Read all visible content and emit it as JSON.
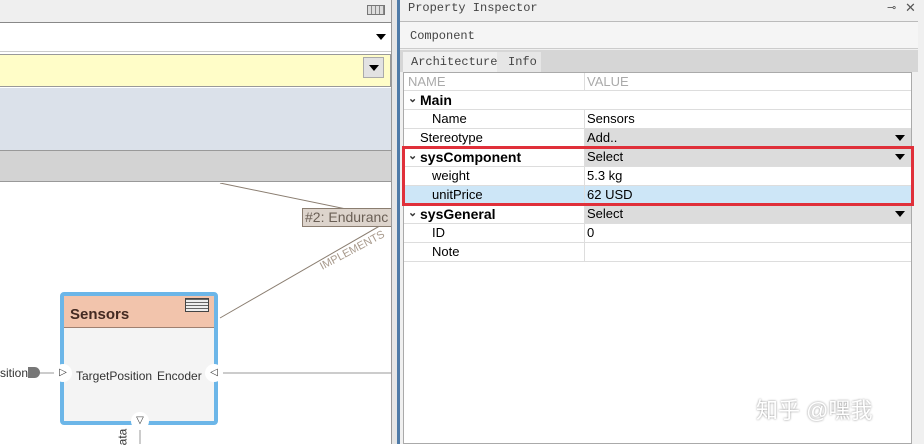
{
  "inspector": {
    "title": "Property Inspector",
    "section": "Component",
    "tabs": [
      {
        "label": "Architecture",
        "active": true
      },
      {
        "label": "Info",
        "active": false
      }
    ],
    "columns": {
      "name": "NAME",
      "value": "VALUE"
    },
    "rows": [
      {
        "name": "Main",
        "value": "",
        "group": true
      },
      {
        "name": "Name",
        "value": "Sensors"
      },
      {
        "name": "Stereotype",
        "value": "Add.."
      },
      {
        "name": "sysComponent",
        "value": "Select",
        "group": true
      },
      {
        "name": "weight",
        "value": "5.3 kg"
      },
      {
        "name": "unitPrice",
        "value": "62 USD"
      },
      {
        "name": "sysGeneral",
        "value": "Select",
        "group": true
      },
      {
        "name": "ID",
        "value": "0"
      },
      {
        "name": "Note",
        "value": ""
      }
    ],
    "highlight_color": "#e0303a"
  },
  "diagram": {
    "component_name": "Sensors",
    "port_in": "TargetPosition",
    "port_out": "Encoder",
    "left_port_label": "sition",
    "bottom_port_label": "ata",
    "requirement": "#2: Enduranc",
    "link_label": "IMPLEMENTS"
  },
  "watermark": "知乎 @嘿我"
}
